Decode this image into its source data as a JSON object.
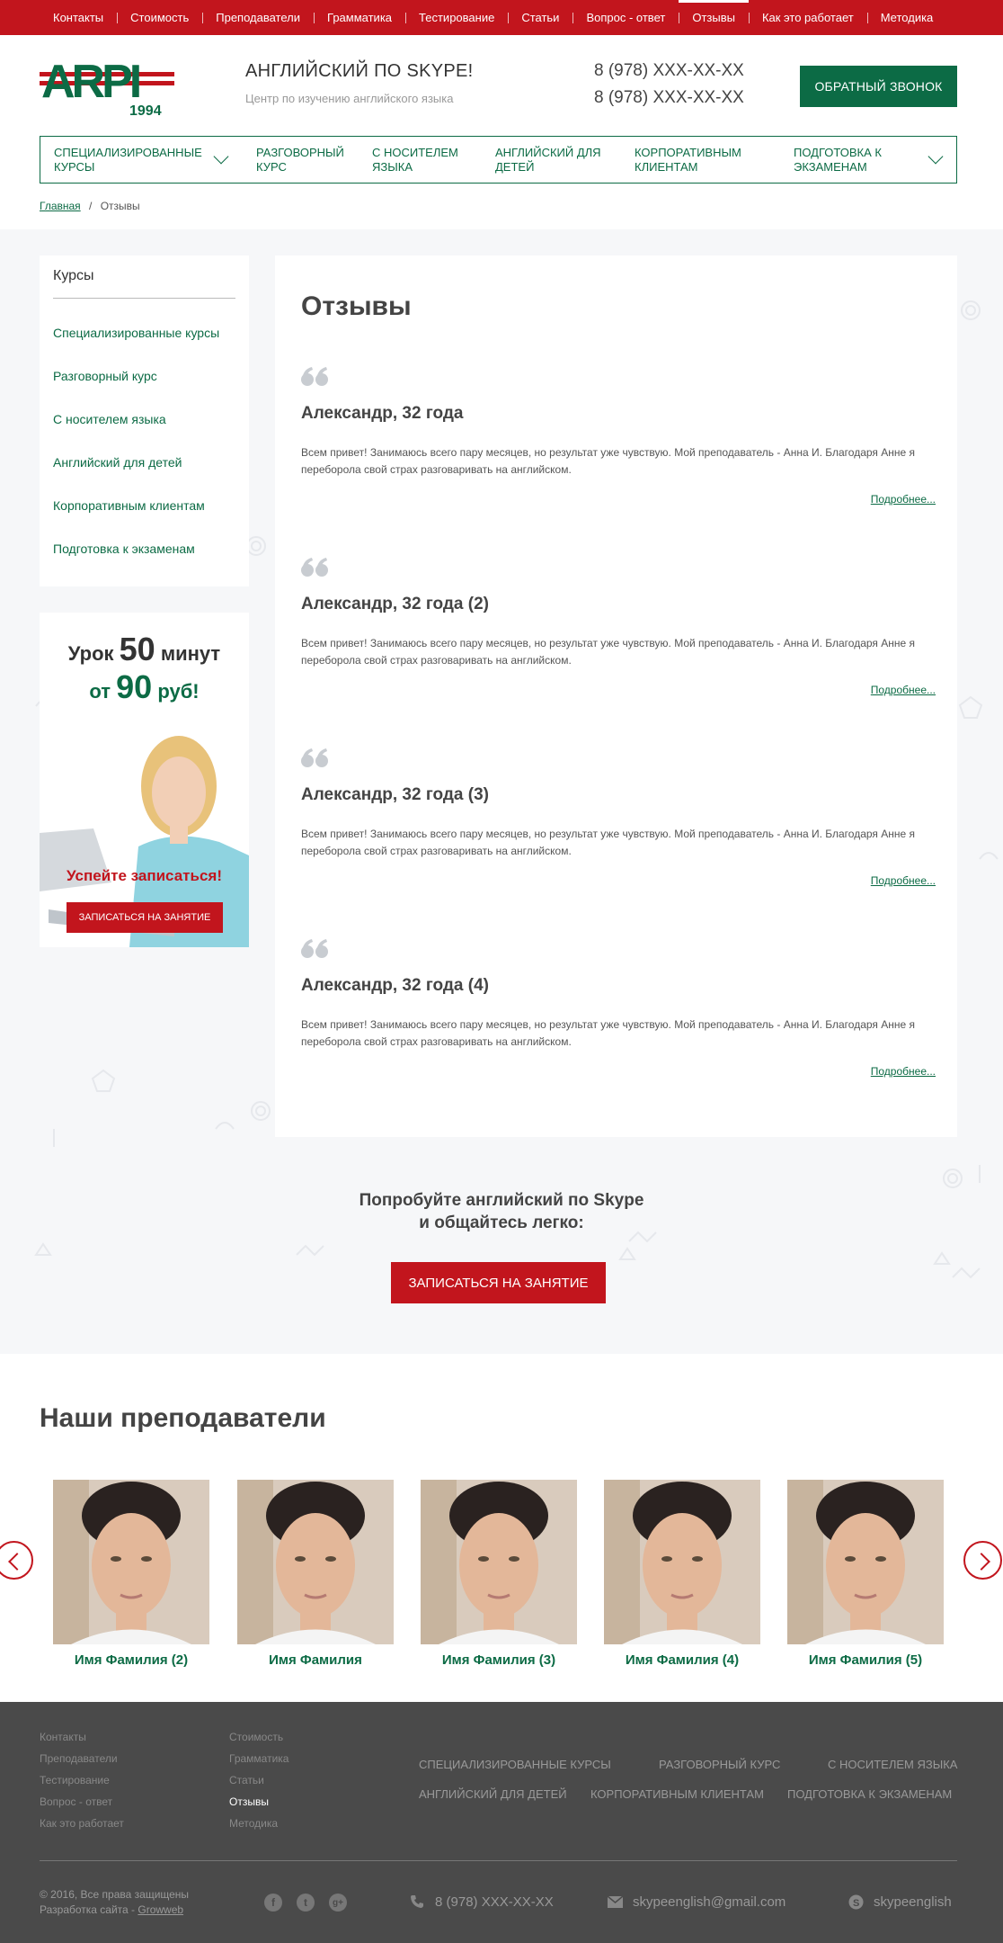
{
  "topnav": [
    "Контакты",
    "Стоимость",
    "Преподаватели",
    "Грамматика",
    "Тестирование",
    "Статьи",
    "Вопрос - ответ",
    "Отзывы",
    "Как это работает",
    "Методика"
  ],
  "topnav_active": "Отзывы",
  "header": {
    "logo_text": "ARPI",
    "logo_year": "1994",
    "title": "АНГЛИЙСКИЙ ПО SKYPE!",
    "subtitle": "Центр по изучению английского языка",
    "phone1": "8 (978) XXX-XX-XX",
    "phone2": "8 (978) XXX-XX-XX",
    "callback_label": "ОБРАТНЫЙ ЗВОНОК"
  },
  "mainnav": [
    {
      "label1": "Специализированные",
      "label2": "курсы"
    },
    {
      "label1": "Разговорный",
      "label2": "курс"
    },
    {
      "label1": "С носителем",
      "label2": "языка"
    },
    {
      "label1": "Английский для",
      "label2": "детей"
    },
    {
      "label1": "Корпоративным",
      "label2": "клиентам"
    },
    {
      "label1": "Подготовка к",
      "label2": "экзаменам"
    }
  ],
  "breadcrumb": {
    "home": "Главная",
    "separator": "/",
    "current": "Отзывы"
  },
  "sidebar": {
    "title": "Курсы",
    "links": [
      "Специализированные курсы",
      "Разговорный курс",
      "С носителем языка",
      "Английский для детей",
      "Корпоративным клиентам",
      "Подготовка к экзаменам"
    ]
  },
  "promo": {
    "line1_a": "Урок ",
    "line1_num": "50",
    "line1_b": " минут",
    "line2_a": "от ",
    "line2_num": "90",
    "line2_b": " руб!",
    "cta": "Успейте записаться!",
    "button": "ЗАПИСАТЬСЯ НА ЗАНЯТИЕ"
  },
  "reviews": {
    "title": "Отзывы",
    "more_label": "Подробнее...",
    "items": [
      {
        "name": "Александр, 32 года",
        "text": "Всем привет! Занимаюсь всего пару месяцев, но результат уже чувствую. Мой преподаватель - Анна И. Благодаря Анне я переборола свой страх разговаривать на английском."
      },
      {
        "name": "Александр, 32 года (2)",
        "text": "Всем привет! Занимаюсь всего пару месяцев, но результат уже чувствую. Мой преподаватель - Анна И. Благодаря Анне я переборола свой страх разговаривать на английском."
      },
      {
        "name": "Александр, 32 года (3)",
        "text": "Всем привет! Занимаюсь всего пару месяцев, но результат уже чувствую. Мой преподаватель - Анна И. Благодаря Анне я переборола свой страх разговаривать на английском."
      },
      {
        "name": "Александр, 32 года (4)",
        "text": "Всем привет! Занимаюсь всего пару месяцев, но результат уже чувствую. Мой преподаватель - Анна И. Благодаря Анне я переборола свой страх разговаривать на английском."
      }
    ]
  },
  "trial": {
    "line1": "Попробуйте английский по Skype",
    "line2": "и общайтесь легко:",
    "button": "ЗАПИСАТЬСЯ НА ЗАНЯТИЕ"
  },
  "teachers": {
    "title": "Наши преподаватели",
    "items": [
      "Имя Фамилия (2)",
      "Имя Фамилия",
      "Имя Фамилия (3)",
      "Имя Фамилия (4)",
      "Имя Фамилия (5)"
    ]
  },
  "footer": {
    "col1": [
      "Контакты",
      "Преподаватели",
      "Тестирование",
      "Вопрос - ответ",
      "Как это работает"
    ],
    "col2": [
      "Стоимость",
      "Грамматика",
      "Статьи",
      "Отзывы",
      "Методика"
    ],
    "col2_active": "Отзывы",
    "courses_row1": [
      "Специализированные курсы",
      "Разговорный курс",
      "С носителем языка"
    ],
    "courses_row2": [
      "Английский для детей",
      "Корпоративным клиентам",
      "Подготовка к экзаменам"
    ],
    "copyright": "© 2016, Все права защищены",
    "developer_prefix": "Разработка сайта - ",
    "developer": "Growweb",
    "social": [
      "f",
      "t",
      "g+"
    ],
    "phone": "8 (978) XXX-XX-XX",
    "email": "skypeenglish@gmail.com",
    "skype": "skypeenglish"
  },
  "colors": {
    "red": "#c2151d",
    "green": "#0c6b45",
    "footer_bg": "#4a4a4a",
    "page_bg": "#f6f7f9"
  }
}
